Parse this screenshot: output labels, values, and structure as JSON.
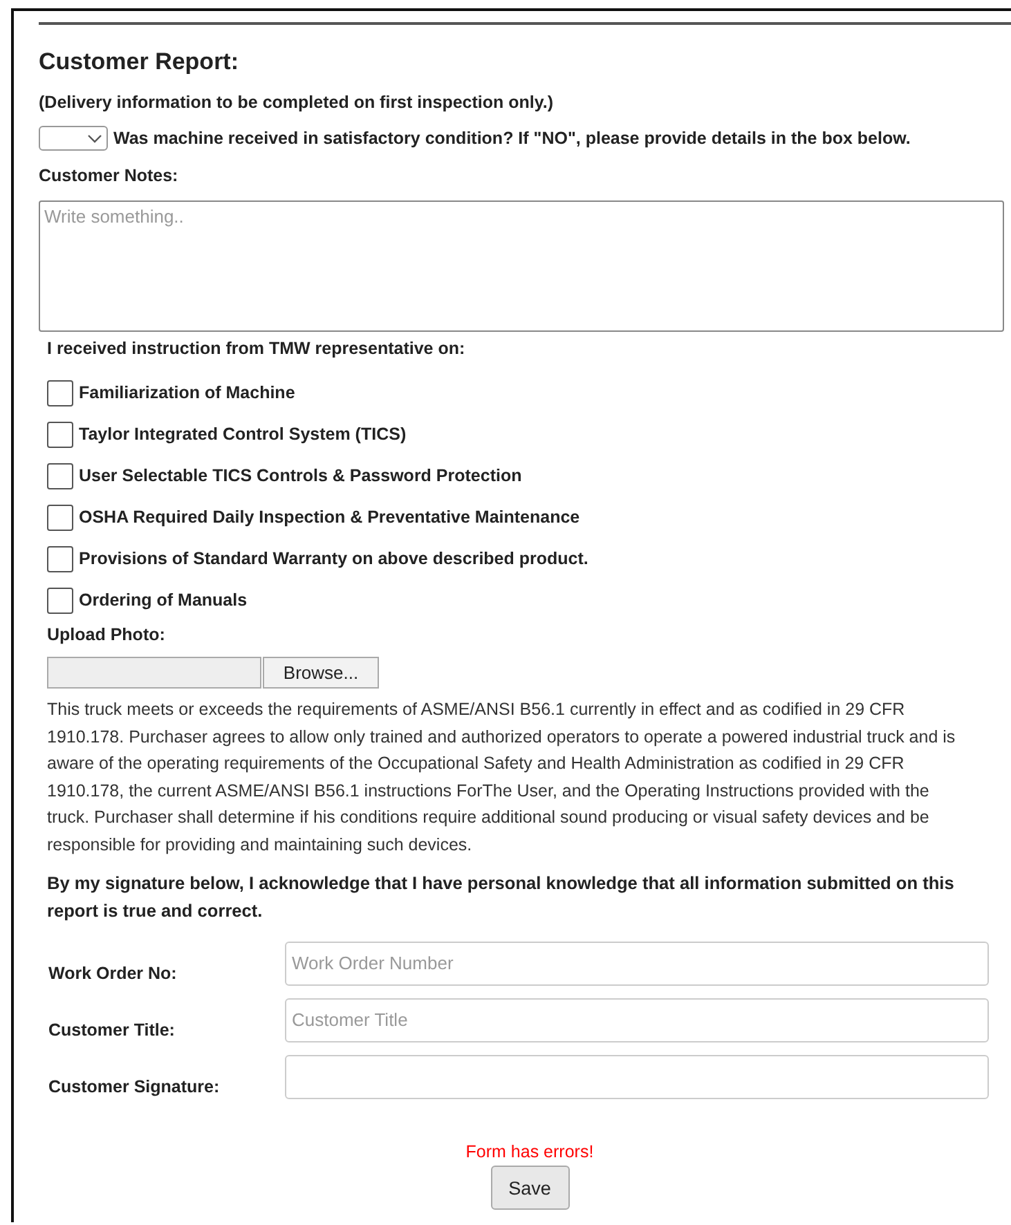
{
  "header": {
    "title": "Customer Report:",
    "subtitle": "(Delivery information to be completed on first inspection only.)"
  },
  "condition": {
    "question": "Was machine received in satisfactory condition? If \"NO\", please provide details in the box below."
  },
  "notes": {
    "label": "Customer Notes:",
    "placeholder": "Write something.."
  },
  "instruction": {
    "label": "I received instruction from TMW representative on:",
    "items": [
      {
        "label": "Familiarization of Machine",
        "checked": false
      },
      {
        "label": "Taylor Integrated Control System (TICS)",
        "checked": false
      },
      {
        "label": "User Selectable TICS Controls & Password Protection",
        "checked": false
      },
      {
        "label": "OSHA Required Daily Inspection & Preventative Maintenance",
        "checked": false
      },
      {
        "label": "Provisions of Standard Warranty on above described product.",
        "checked": false
      },
      {
        "label": "Ordering of Manuals",
        "checked": false
      }
    ]
  },
  "upload": {
    "label": "Upload Photo:",
    "button": "Browse..."
  },
  "disclaimer": "This truck meets or exceeds the requirements of ASME/ANSI B56.1 currently in effect and as codified in 29 CFR 1910.178. Purchaser agrees to allow only trained and authorized operators to operate a powered industrial truck and is aware of the operating requirements of the Occupational Safety and Health Administration as codified in 29 CFR 1910.178, the current ASME/ANSI B56.1 instructions ForThe User, and the Operating Instructions provided with the truck. Purchaser shall determine if his conditions require additional sound producing or visual safety devices and be responsible for providing and maintaining such devices.",
  "acknowledgement": "By my signature below, I acknowledge that I have personal knowledge that all information submitted on this report is true and correct.",
  "fields": [
    {
      "label": "Work Order No:",
      "placeholder": "Work Order Number"
    },
    {
      "label": "Customer Title:",
      "placeholder": "Customer Title"
    },
    {
      "label": "Customer Signature:"
    }
  ],
  "error": "Form has errors!",
  "save_button": "Save"
}
